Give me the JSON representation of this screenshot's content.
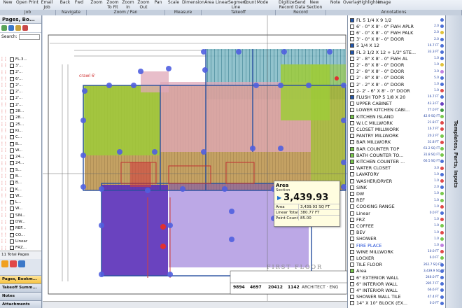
{
  "ribbon": {
    "buttons": [
      {
        "label": "New"
      },
      {
        "label": "Open"
      },
      {
        "label": "Print"
      },
      {
        "label": "Email\nJob"
      },
      {
        "label": "Back"
      },
      {
        "label": "Fwd"
      },
      {
        "label": "Zoom"
      },
      {
        "label": "Zoom\nTo Fit"
      },
      {
        "label": "Zoom\nIn"
      },
      {
        "label": "Zoom\nOut"
      },
      {
        "label": "Pan"
      },
      {
        "label": "Scale"
      },
      {
        "label": "Dimension"
      },
      {
        "label": "Area"
      },
      {
        "label": "Linear"
      },
      {
        "label": "Segment\nLine"
      },
      {
        "label": "Count"
      },
      {
        "label": "Mode"
      },
      {
        "label": "Digitizer\nRecord"
      },
      {
        "label": "Send\nData"
      },
      {
        "label": "New\nSection"
      },
      {
        "label": "Note"
      },
      {
        "label": "Overlay"
      },
      {
        "label": "Highlighter"
      },
      {
        "label": "Image"
      }
    ],
    "groups": [
      "Job",
      "Navigate",
      "Zoom / Pan",
      "Measure",
      "Takeoff",
      "Record",
      "Annotations"
    ]
  },
  "left_panel": {
    "title": "Pages, Bo...",
    "search_label": "Search:",
    "pages": [
      "FL.3...",
      "3'...",
      "2'...",
      "6'...",
      "2'...",
      "2'...",
      "2'...",
      "2'...",
      "28...",
      "28...",
      "25...",
      "Ki...",
      "C...",
      "B...",
      "W...",
      "24...",
      "24...",
      "S...",
      "B...",
      "B...",
      "K...",
      "W...",
      "L...",
      "W...",
      "SIN...",
      "DW...",
      "REF...",
      "CO...",
      "Linear",
      "FRZ...",
      "COF...",
      "BEV...",
      "SHO...",
      "FI...",
      "WI..."
    ],
    "selected_page": "FI...",
    "total_pages": "11 Total Pages",
    "nav": [
      "Pages, Bookm...",
      "Takeoff Summ...",
      "Notes",
      "Attachments"
    ]
  },
  "tooltip": {
    "title": "Area",
    "subtitle": "Section",
    "value": "3,439.93",
    "rows": [
      {
        "k": "Area",
        "v": "3,439.93 SQ FT"
      },
      {
        "k": "Linear Total",
        "v": "380.77 FT"
      },
      {
        "k": "Point Count",
        "v": "85.00"
      }
    ]
  },
  "drawing": {
    "floor_label": "FIRST FLOOR",
    "title_block": [
      "9894",
      "4697",
      "20412",
      "1142"
    ],
    "architect": "ARCHITECT · ENG"
  },
  "takeoff": [
    {
      "name": "FL 5 1/4 X 9 1/2",
      "qty": "",
      "color": "#2255aa",
      "dot": "#4c6fd6"
    },
    {
      "name": "6' - 0\" X 8' - 0\" FWH APLR",
      "qty": "2.0",
      "color": "#ffffff",
      "dot": "#4c6fd6"
    },
    {
      "name": "6' - 0\" X 8' - 0\" FWH PALK",
      "qty": "2.0",
      "color": "#ffffff",
      "dot": "#e0c23a"
    },
    {
      "name": "3' - 0\" X 8' - 0\" DOOR",
      "qty": "2.0",
      "color": "#ffffff",
      "dot": "#4c6fd6"
    },
    {
      "name": "5 1/4 X 12",
      "qty": "16.7 FT",
      "color": "#2255aa",
      "dot": "#4c6fd6"
    },
    {
      "name": "FL 3 1/2 X 12 + 1/2\" STE...",
      "qty": "33.3 FT",
      "color": "#2255aa",
      "dot": "#4c6fd6"
    },
    {
      "name": "2' - 8\" X 8' - 0\" FWH AL",
      "qty": "1.0",
      "color": "#ffffff",
      "dot": "#4c6fd6"
    },
    {
      "name": "2' - 8\" X 8' - 0\" DOOR",
      "qty": "1.0",
      "color": "#ffffff",
      "dot": "#e0c23a"
    },
    {
      "name": "2' - 8\" X 8' - 0\" DOOR",
      "qty": "3.0",
      "color": "#ffffff",
      "dot": "#c080e0"
    },
    {
      "name": "2' - 8\" X 8' - 0\" DOOR",
      "qty": "5.0",
      "color": "#ffffff",
      "dot": "#4c6fd6"
    },
    {
      "name": "2' - 2\" X 8' - 0\" DOOR",
      "qty": "1.0",
      "color": "#ffffff",
      "dot": "#4c6fd6"
    },
    {
      "name": "2- 2' - 6\" X 8' - 0\" DOOR",
      "qty": "1.0",
      "color": "#ffffff",
      "dot": "#e04848"
    },
    {
      "name": "FLUSH TOP 5 1/8 X 20",
      "qty": "16.7 FT",
      "color": "#2255aa",
      "dot": "#4c6fd6"
    },
    {
      "name": "UPPER CABINET",
      "qty": "43.3 FT",
      "color": "#ffffff",
      "dot": "#6a3fc0"
    },
    {
      "name": "LOWER KITCHEN CABI...",
      "qty": "77.0 FT",
      "color": "#ffffff",
      "dot": "#3e9a3e"
    },
    {
      "name": "KITCHEN ISLAND",
      "qty": "42.9 SQ FT",
      "color": "#78c84c",
      "dot": "#78c84c"
    },
    {
      "name": "W.I.C MILLWORK",
      "qty": "21.8 FT",
      "color": "#ffffff",
      "dot": "#e04848"
    },
    {
      "name": "CLOSET MILLWORK",
      "qty": "16.7 FT",
      "color": "#ffffff",
      "dot": "#e04848"
    },
    {
      "name": "PANTRY MILLWORK",
      "qty": "20.2 FT",
      "color": "#ffffff",
      "dot": "#78c84c"
    },
    {
      "name": "BAR MILLWORK",
      "qty": "31.8 FT",
      "color": "#ffffff",
      "dot": "#e04848"
    },
    {
      "name": "BAR COUNTER TOP",
      "qty": "61.2 SQ FT",
      "color": "#78c84c",
      "dot": "#78c84c"
    },
    {
      "name": "BATH COUNTER TO...",
      "qty": "31.8 SQ FT",
      "color": "#78c84c",
      "dot": "#78c84c"
    },
    {
      "name": "KITCHEN COUNTER ...",
      "qty": "66.5 SQ FT",
      "color": "#78c84c",
      "dot": "#4c6fd6"
    },
    {
      "name": "WATER CLOSET",
      "qty": "3.0",
      "color": "#ffffff",
      "dot": "#e04848"
    },
    {
      "name": "LAVATORY",
      "qty": "1.0",
      "color": "#ffffff",
      "dot": "#4c6fd6"
    },
    {
      "name": "WASHER/DRYER",
      "qty": "1.0",
      "color": "#ffffff",
      "dot": "#e04848"
    },
    {
      "name": "SINK",
      "qty": "2.0",
      "color": "#ffffff",
      "dot": "#4c6fd6"
    },
    {
      "name": "DW",
      "qty": "1.0",
      "color": "#ffffff",
      "dot": "#78c84c"
    },
    {
      "name": "REF",
      "qty": "1.0",
      "color": "#ffffff",
      "dot": "#78c84c"
    },
    {
      "name": "COOKING RANGE",
      "qty": "1.0",
      "color": "#ffffff",
      "dot": "#e04848"
    },
    {
      "name": "Linear",
      "qty": "0.0 FT",
      "color": "#ffffff",
      "dot": "#4c6fd6"
    },
    {
      "name": "FRZ",
      "qty": "1.0",
      "color": "#ffffff",
      "dot": "#e04848"
    },
    {
      "name": "COFFEE",
      "qty": "1.0",
      "color": "#ffffff",
      "dot": "#78c84c"
    },
    {
      "name": "BEV",
      "qty": "1.0",
      "color": "#ffffff",
      "dot": "#e04848"
    },
    {
      "name": "SHOWER",
      "qty": "1.0",
      "color": "#ffffff",
      "dot": "#78c84c"
    },
    {
      "name": "FIRE PLACE",
      "qty": "1.0",
      "color": "#ffffff",
      "dot": "#c080e0",
      "blue": true
    },
    {
      "name": "WINE MILLWORK",
      "qty": "10.0 FT",
      "color": "#ffffff",
      "dot": "#e04848"
    },
    {
      "name": "LOCKER",
      "qty": "6.0 FT",
      "color": "#ffffff",
      "dot": "#78c84c"
    },
    {
      "name": "TILE FLOOR",
      "qty": "262.7 SQ FT",
      "color": "#ffffff",
      "dot": "#4c6fd6"
    },
    {
      "name": "Area",
      "qty": "3,439.9 SQ FT",
      "color": "#78c84c",
      "dot": "#4c6fd6"
    },
    {
      "name": "6\" EXTERIOR WALL",
      "qty": "246.0 FT",
      "color": "#ffffff",
      "dot": "#4c6fd6"
    },
    {
      "name": "6\" INTERIOR WALL",
      "qty": "285.7 FT",
      "color": "#ffffff",
      "dot": "#4c6fd6"
    },
    {
      "name": "4\" INTERIOR WALL",
      "qty": "66.6 FT",
      "color": "#ffffff",
      "dot": "#4c6fd6"
    },
    {
      "name": "SHOWER WALL TILE",
      "qty": "47.4 FT",
      "color": "#ffffff",
      "dot": "#4c6fd6"
    },
    {
      "name": "14\" X 10\" BLOCK (EX...",
      "qty": "0.0 FT",
      "color": "#ffffff",
      "dot": "#4c6fd6"
    }
  ],
  "side_tab": "Templates, Parts, Inputs"
}
